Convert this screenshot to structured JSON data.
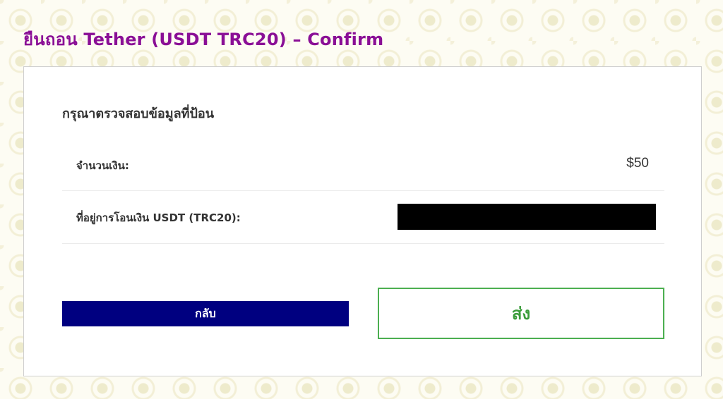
{
  "page": {
    "title": "ยืนถอน Tether (USDT TRC20) – Confirm"
  },
  "form": {
    "heading": "กรุณาตรวจสอบข้อมูลที่ป้อน",
    "fields": [
      {
        "label": "จำนวนเงิน:",
        "value": "$50"
      },
      {
        "label": "ที่อยู่การโอนเงิน USDT (TRC20):",
        "value": ""
      }
    ]
  },
  "buttons": {
    "back_label": "กลับ",
    "submit_label": "ส่ง"
  },
  "colors": {
    "title": "#8a0f96",
    "back_button_bg": "#000080",
    "submit_border": "#4caf50",
    "submit_text": "#3a9c3a",
    "redaction": "#000000",
    "page_background": "#fdfcf3"
  }
}
